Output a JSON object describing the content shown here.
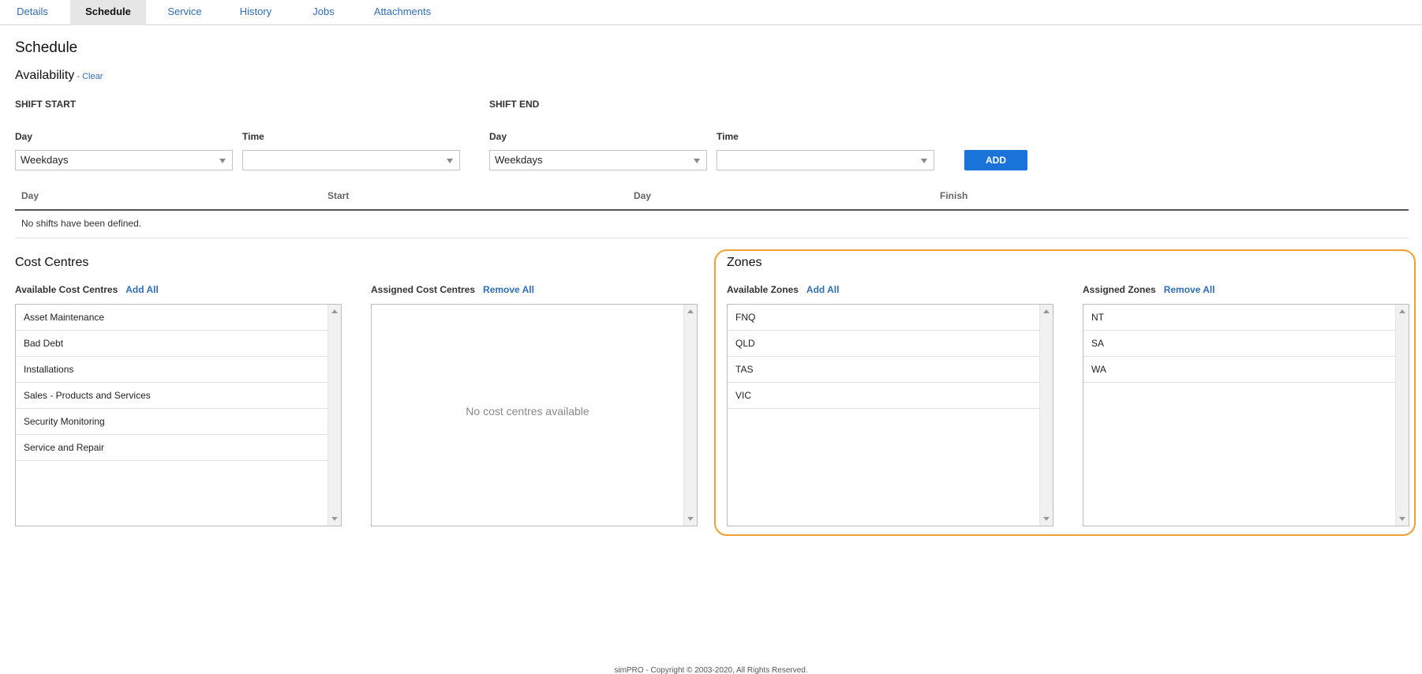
{
  "tabs": [
    {
      "label": "Details",
      "active": false
    },
    {
      "label": "Schedule",
      "active": true
    },
    {
      "label": "Service",
      "active": false
    },
    {
      "label": "History",
      "active": false
    },
    {
      "label": "Jobs",
      "active": false
    },
    {
      "label": "Attachments",
      "active": false
    }
  ],
  "page_title": "Schedule",
  "availability": {
    "title": "Availability",
    "separator": " - ",
    "clear_label": "Clear",
    "shift_start": {
      "title": "SHIFT START",
      "day_label": "Day",
      "day_value": "Weekdays",
      "time_label": "Time",
      "time_value": ""
    },
    "shift_end": {
      "title": "SHIFT END",
      "day_label": "Day",
      "day_value": "Weekdays",
      "time_label": "Time",
      "time_value": ""
    },
    "add_label": "ADD",
    "table_headers": [
      "Day",
      "Start",
      "Day",
      "Finish"
    ],
    "empty_text": "No shifts have been defined."
  },
  "cost_centres": {
    "title": "Cost Centres",
    "available_label": "Available Cost Centres",
    "add_all_label": "Add All",
    "assigned_label": "Assigned Cost Centres",
    "remove_all_label": "Remove All",
    "available_items": [
      "Asset Maintenance",
      "Bad Debt",
      "Installations",
      "Sales - Products and Services",
      "Security Monitoring",
      "Service and Repair"
    ],
    "assigned_items": [],
    "assigned_empty_text": "No cost centres available"
  },
  "zones": {
    "title": "Zones",
    "available_label": "Available Zones",
    "add_all_label": "Add All",
    "assigned_label": "Assigned Zones",
    "remove_all_label": "Remove All",
    "available_items": [
      "FNQ",
      "QLD",
      "TAS",
      "VIC"
    ],
    "assigned_items": [
      "NT",
      "SA",
      "WA"
    ]
  },
  "highlight_color": "#f0a030",
  "accent_color": "#1a73d9",
  "footer": "simPRO - Copyright © 2003-2020, All Rights Reserved."
}
